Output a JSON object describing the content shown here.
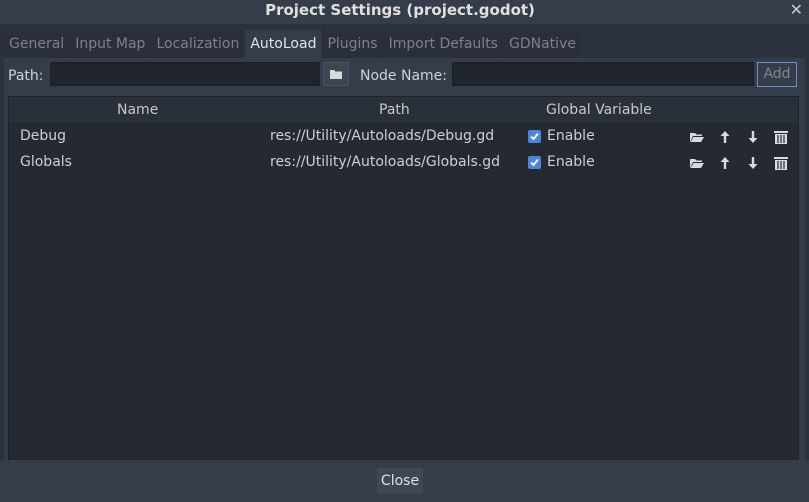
{
  "window": {
    "title": "Project Settings (project.godot)",
    "close_glyph": "✕"
  },
  "tabs": [
    {
      "label": "General",
      "active": false
    },
    {
      "label": "Input Map",
      "active": false
    },
    {
      "label": "Localization",
      "active": false
    },
    {
      "label": "AutoLoad",
      "active": true
    },
    {
      "label": "Plugins",
      "active": false
    },
    {
      "label": "Import Defaults",
      "active": false
    },
    {
      "label": "GDNative",
      "active": false
    }
  ],
  "autoload_form": {
    "path_label": "Path:",
    "path_value": "",
    "node_name_label": "Node Name:",
    "node_name_value": "",
    "browse_icon": "folder-icon",
    "add_label": "Add"
  },
  "table": {
    "columns": [
      "Name",
      "Path",
      "Global Variable"
    ],
    "rows": [
      {
        "name": "Debug",
        "path": "res://Utility/Autoloads/Debug.gd",
        "enable_label": "Enable",
        "enabled": true
      },
      {
        "name": "Globals",
        "path": "res://Utility/Autoloads/Globals.gd",
        "enable_label": "Enable",
        "enabled": true
      }
    ],
    "row_actions": [
      "open-folder-icon",
      "move-up-icon",
      "move-down-icon",
      "delete-icon"
    ]
  },
  "footer": {
    "close_label": "Close"
  },
  "colors": {
    "accent": "#4a86d8",
    "background": "#363d4a",
    "table_background": "#252a32",
    "text": "#cdcfd2"
  }
}
